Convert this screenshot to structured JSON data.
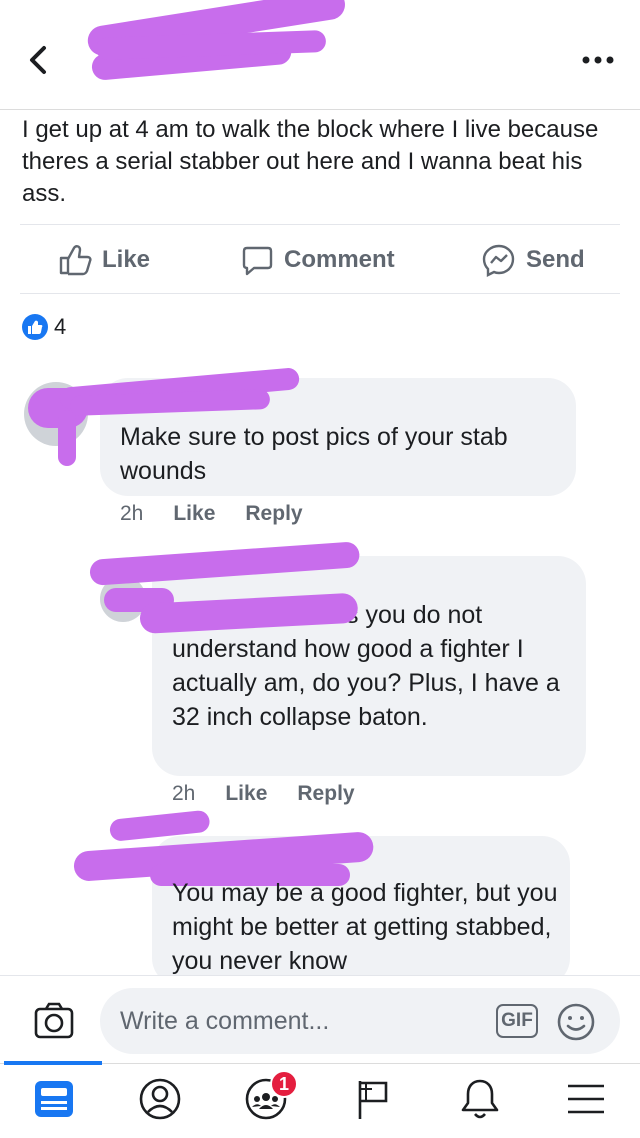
{
  "post": {
    "text": "I get up at 4 am to walk the block where I live because theres a serial stabber out here and I wanna beat his ass."
  },
  "actions": {
    "like": "Like",
    "comment": "Comment",
    "send": "Send"
  },
  "reactions": {
    "count": "4"
  },
  "comments": [
    {
      "text": "Make sure to post pics of your stab wounds",
      "time": "2h",
      "like": "Like",
      "reply": "Reply"
    },
    {
      "text_line1": "s you do  not",
      "text_rest": "understand how good a fighter I actually am, do you? Plus, I have a 32 inch collapse baton.",
      "time": "2h",
      "like": "Like",
      "reply": "Reply"
    },
    {
      "text": "You may be a good fighter, but you might be better at getting stabbed, you never know"
    }
  ],
  "composer": {
    "placeholder": "Write a comment...",
    "gif": "GIF"
  },
  "tabbar": {
    "groups_badge": "1"
  },
  "colors": {
    "accent": "#1877f2",
    "redaction": "#c86dec",
    "bubble": "#f0f2f5",
    "badge": "#e41e3f"
  },
  "icons": [
    "back-arrow-icon",
    "more-icon",
    "like-icon",
    "comment-icon",
    "messenger-icon",
    "camera-icon",
    "emoji-icon",
    "news-feed-icon",
    "profile-icon",
    "groups-icon",
    "pages-flag-icon",
    "bell-icon",
    "menu-icon"
  ]
}
